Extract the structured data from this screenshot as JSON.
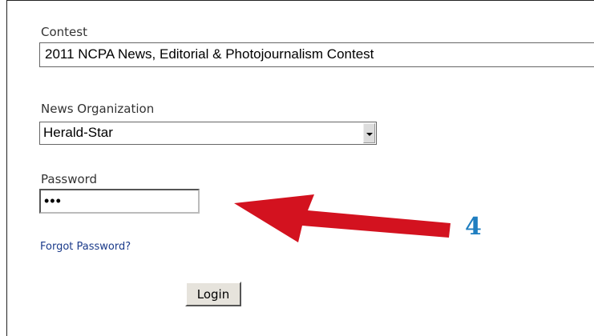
{
  "contest": {
    "label": "Contest",
    "value": "2011 NCPA News, Editorial & Photojournalism Contest"
  },
  "news_organization": {
    "label": "News Organization",
    "selected": "Herald-Star"
  },
  "password": {
    "label": "Password",
    "masked_value": "•••"
  },
  "links": {
    "forgot_password": "Forgot Password?"
  },
  "buttons": {
    "login": "Login"
  },
  "annotation": {
    "step_number": "4",
    "arrow_color": "#d3121f",
    "number_color": "#1f7ec0"
  },
  "colors": {
    "link": "#1a3a8a",
    "button_face": "#e6e3dc"
  }
}
